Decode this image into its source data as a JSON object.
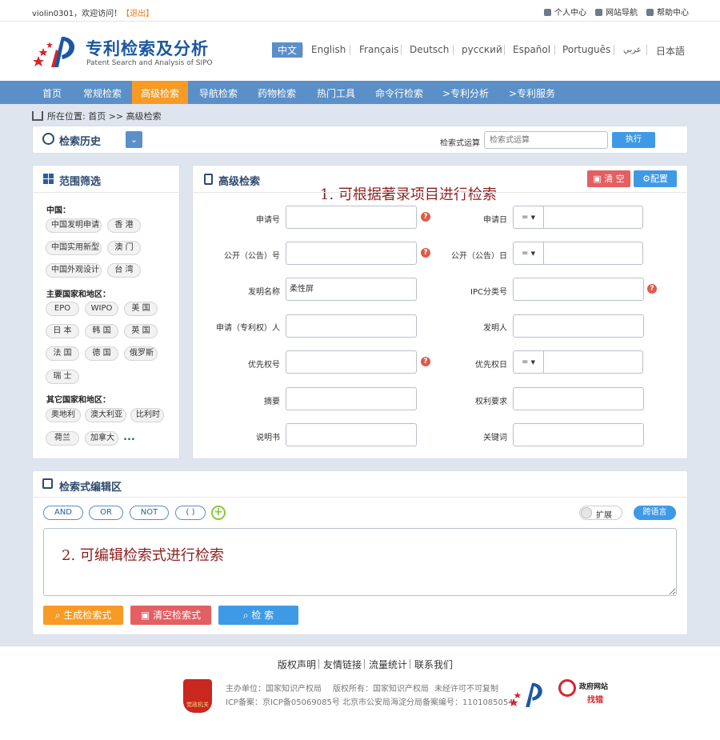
{
  "topbar": {
    "user": "violin0301，欢迎访问！",
    "logout": "【退出】",
    "links": [
      "个人中心",
      "网站导航",
      "帮助中心"
    ]
  },
  "logo": {
    "title": "专利检索及分析",
    "subtitle": "Patent Search and Analysis of SIPO"
  },
  "languages": [
    "中文",
    "English",
    "Français",
    "Deutsch",
    "русский",
    "Español",
    "Português",
    "عربي",
    "日本語"
  ],
  "nav": [
    "首页",
    "常规检索",
    "高级检索",
    "导航检索",
    "药物检索",
    "热门工具",
    "命令行检索",
    ">专利分析",
    ">专利服务"
  ],
  "breadcrumb": "所在位置: 首页 >> 高级检索",
  "history": {
    "title": "检索历史",
    "op_label": "检索式运算",
    "op_placeholder": "检索式运算",
    "exec": "执行"
  },
  "scope": {
    "title": "范围筛选",
    "groups": [
      {
        "label": "中国：",
        "tags": [
          "中国发明申请",
          "香 港",
          "中国实用新型",
          "澳 门",
          "中国外观设计",
          "台 湾"
        ]
      },
      {
        "label": "主要国家和地区：",
        "tags": [
          "EPO",
          "WIPO",
          "美 国",
          "日 本",
          "韩 国",
          "英 国",
          "法 国",
          "德 国",
          "俄罗斯",
          "瑞 士"
        ]
      },
      {
        "label": "其它国家和地区：",
        "tags": [
          "奥地利",
          "澳大利亚",
          "比利时",
          "荷兰",
          "加拿大"
        ],
        "more": "..."
      }
    ]
  },
  "advanced": {
    "title": "高级检索",
    "annotation": "1. 可根据著录项目进行检索",
    "clear": "清 空",
    "config": "配置",
    "fields_left": [
      {
        "label": "申请号",
        "value": "",
        "help": "?"
      },
      {
        "label": "公开（公告）号",
        "value": "",
        "help": "?"
      },
      {
        "label": "发明名称",
        "value": "柔性屏"
      },
      {
        "label": "申请（专利权）人",
        "value": ""
      },
      {
        "label": "优先权号",
        "value": "",
        "help": "?"
      },
      {
        "label": "摘要",
        "value": ""
      },
      {
        "label": "说明书",
        "value": ""
      }
    ],
    "fields_right": [
      {
        "label": "申请日",
        "op": "=",
        "value": ""
      },
      {
        "label": "公开（公告）日",
        "op": "=",
        "value": ""
      },
      {
        "label": "IPC分类号",
        "value": "",
        "help": "?"
      },
      {
        "label": "发明人",
        "value": ""
      },
      {
        "label": "优先权日",
        "op": "=",
        "value": ""
      },
      {
        "label": "权利要求",
        "value": ""
      },
      {
        "label": "关键词",
        "value": ""
      }
    ]
  },
  "editor": {
    "title": "检索式编辑区",
    "ops": [
      "AND",
      "OR",
      "NOT",
      "( )"
    ],
    "add": "+",
    "expand": "扩展",
    "crosslang": "跨语言",
    "annotation": "2. 可编辑检索式进行检索",
    "gen": "生成检索式",
    "clear": "清空检索式",
    "search": "检 索"
  },
  "footer": {
    "links": [
      "版权声明",
      "友情链接",
      "流量统计",
      "联系我们"
    ],
    "host": "主办单位：国家知识产权局",
    "owner": "版权所有：国家知识产权局",
    "copy": "未经许可不可复制",
    "icp": "ICP备案：京ICP备05069085号 北京市公安局海淀分局备案编号：1101085054",
    "gov_badge": "党政机关",
    "gov": "政府网站",
    "gov_sub": "找错"
  },
  "colors": {
    "nav": "#5b8fc7",
    "active": "#f79b25",
    "red": "#e35f62",
    "blue": "#3f9ae6"
  }
}
